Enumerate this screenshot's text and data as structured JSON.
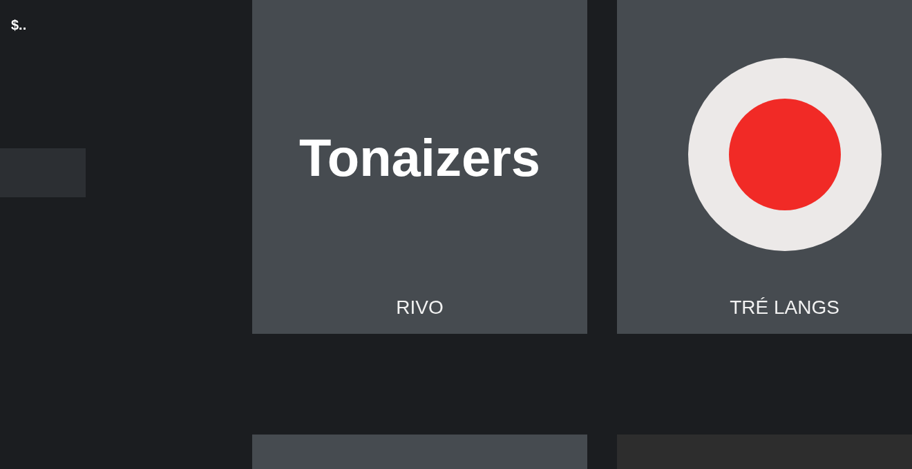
{
  "header": {
    "text": "$.."
  },
  "tiles": [
    {
      "kind": "logo",
      "logo_text": "Tonaizers",
      "label": "RIVO"
    },
    {
      "kind": "record",
      "label": "TRÉ LANGS"
    },
    {
      "kind": "blank"
    },
    {
      "kind": "dark"
    }
  ]
}
